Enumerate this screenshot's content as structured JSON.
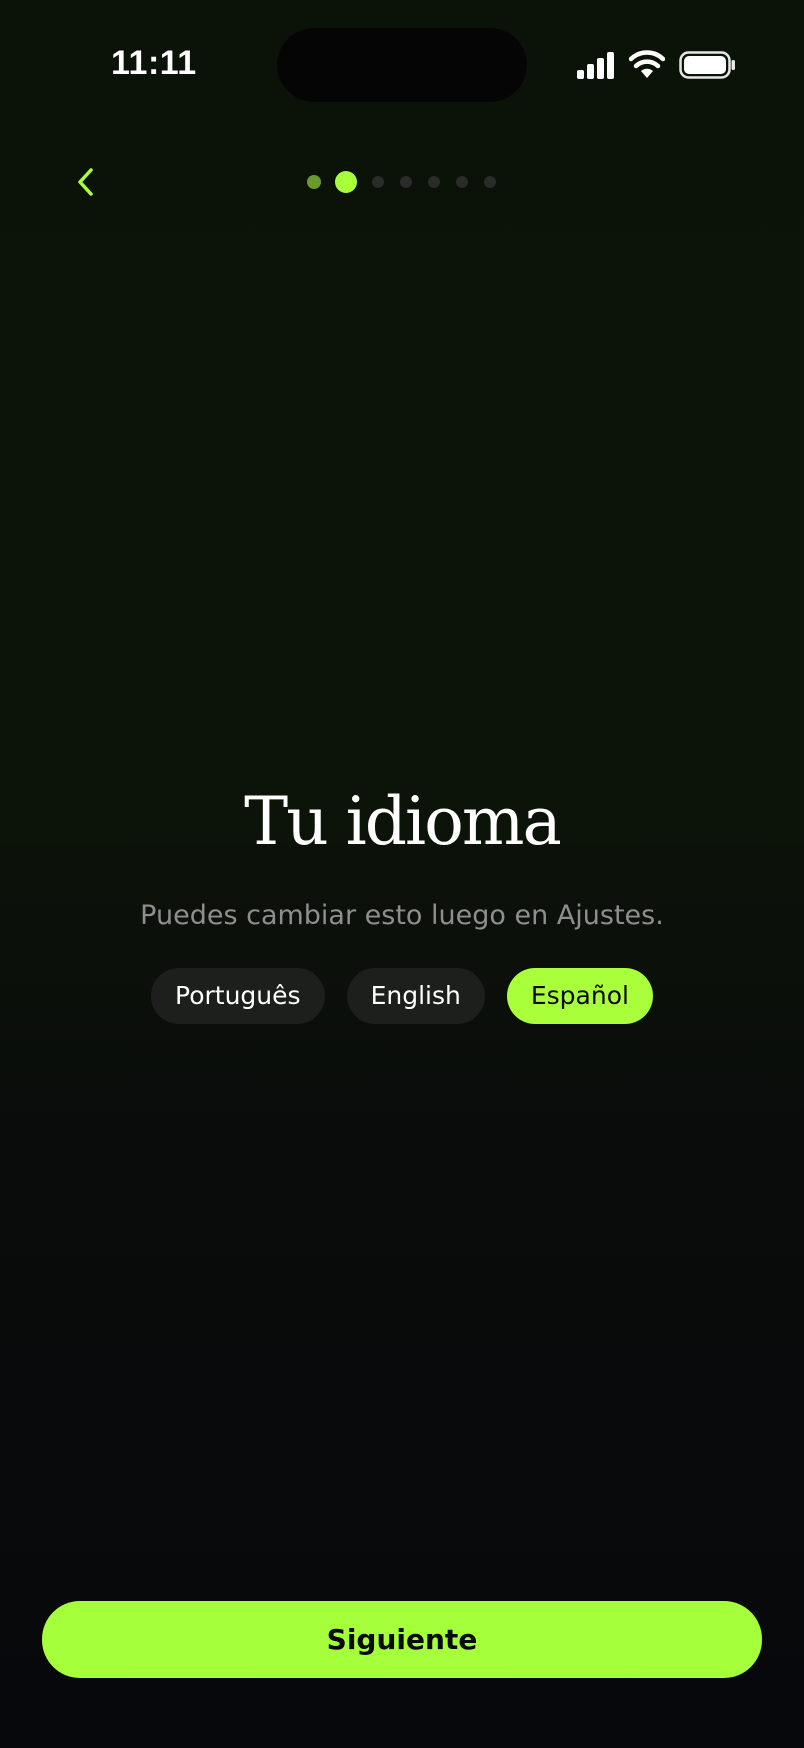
{
  "status_bar": {
    "time": "11:11",
    "icons": [
      "cellular-signal-icon",
      "wifi-icon",
      "battery-icon"
    ]
  },
  "nav": {
    "back_icon": "chevron-left-icon",
    "pager": {
      "total_steps": 7,
      "current_step": 2
    }
  },
  "main": {
    "title": "Tu idioma",
    "subtitle": "Puedes cambiar esto luego en Ajustes.",
    "languages": [
      {
        "label": "Português",
        "selected": false
      },
      {
        "label": "English",
        "selected": false
      },
      {
        "label": "Español",
        "selected": true
      }
    ]
  },
  "footer": {
    "next_label": "Siguiente"
  },
  "colors": {
    "accent": "#a8ff3a",
    "chip_bg": "#1d1f1d",
    "subtitle": "#8d8f8c"
  }
}
